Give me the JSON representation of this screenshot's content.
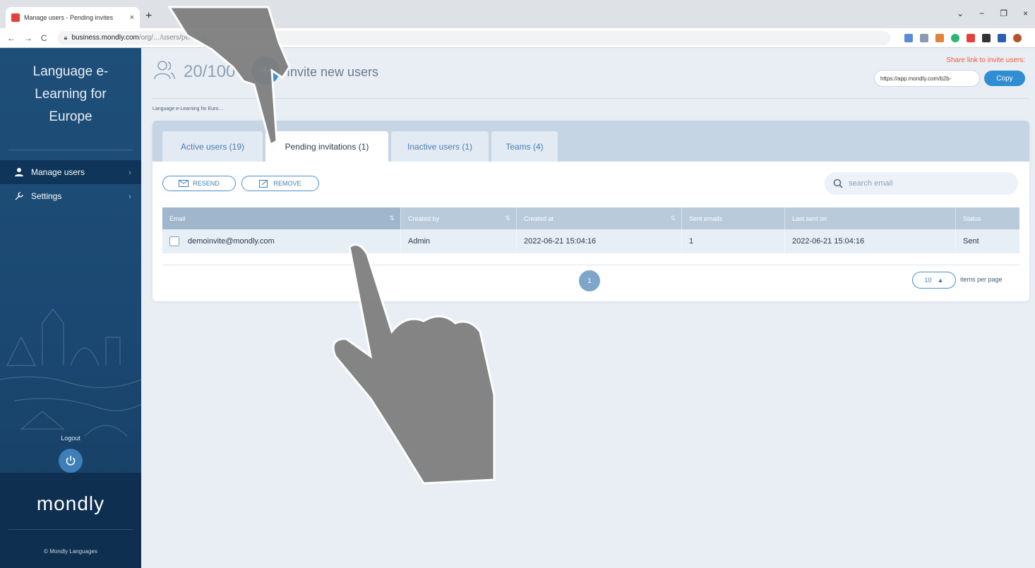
{
  "browser": {
    "tab_title": "Manage users - Pending invites",
    "tab_close": "×",
    "new_tab": "+",
    "url_domain": "business.mondly.com",
    "url_path": "/org/…/users/pending",
    "window_controls": [
      "⌄",
      "−",
      "❐",
      "×"
    ]
  },
  "sidebar": {
    "org_name": "Language e-Learning for Europe",
    "items": [
      {
        "label": "Manage users",
        "icon": "user-icon",
        "active": true
      },
      {
        "label": "Settings",
        "icon": "wrench-icon",
        "active": false
      }
    ],
    "logout_label": "Logout",
    "brand": "mondly",
    "copyright": "© Mondly Languages"
  },
  "header": {
    "user_count": "20/100",
    "invite_label": "Invite new users",
    "share_label": "Share link to invite users:",
    "share_link": "https://app.mondly.com/b2b-",
    "copy_label": "Copy"
  },
  "breadcrumb": "Language e-Learning for Euro…",
  "tabs": [
    {
      "label": "Active users (19)",
      "active": false
    },
    {
      "label": "Pending invitations (1)",
      "active": true
    },
    {
      "label": "Inactive users (1)",
      "active": false
    },
    {
      "label": "Teams (4)",
      "active": false
    }
  ],
  "toolbar": {
    "resend_label": "RESEND",
    "remove_label": "REMOVE",
    "search_placeholder": "search email"
  },
  "table": {
    "columns": [
      "Email",
      "Created by",
      "Created at",
      "Sent emails",
      "Last sent on",
      "Status"
    ],
    "rows": [
      {
        "email": "demoinvite@mondly.com",
        "created_by": "Admin",
        "created_at": "2022-06-21 15:04:16",
        "sent_emails": "1",
        "last_sent_on": "2022-06-21 15:04:16",
        "status": "Sent"
      }
    ]
  },
  "pagination": {
    "current_page": "1",
    "per_page": "10",
    "per_page_label": "items per page"
  },
  "colors": {
    "sidebar": "#1e4f79",
    "accent": "#2f8ed1",
    "share_label": "#f05a3a"
  }
}
